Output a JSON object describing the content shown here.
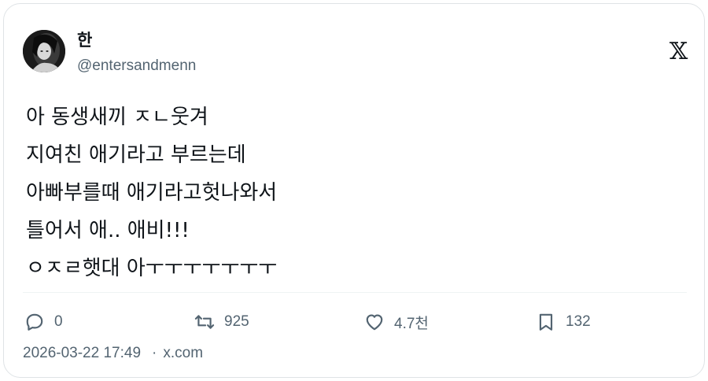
{
  "author": {
    "display_name": "한",
    "handle": "@entersandmenn"
  },
  "brand": {
    "logo_icon": "x-logo-icon"
  },
  "tweet": {
    "lines": [
      "아 동생새끼 ㅈㄴ웃겨",
      "지여친 애기라고 부르는데",
      "아빠부를때 애기라고헛나와서",
      "틀어서 애.. 애비!!!",
      "ㅇㅈㄹ햇대 아ㅜㅜㅜㅜㅜㅜㅜ"
    ]
  },
  "actions": {
    "reply": {
      "icon": "reply-icon",
      "count": "0"
    },
    "retweet": {
      "icon": "retweet-icon",
      "count": "925"
    },
    "like": {
      "icon": "heart-icon",
      "count": "4.7천"
    },
    "bookmark": {
      "icon": "bookmark-icon",
      "count": "132"
    }
  },
  "meta": {
    "timestamp": "2026-03-22 17:49",
    "separator": "·",
    "source": "x.com"
  },
  "colors": {
    "text_primary": "#0f1419",
    "text_secondary": "#536471",
    "border": "#dfe3e6"
  }
}
